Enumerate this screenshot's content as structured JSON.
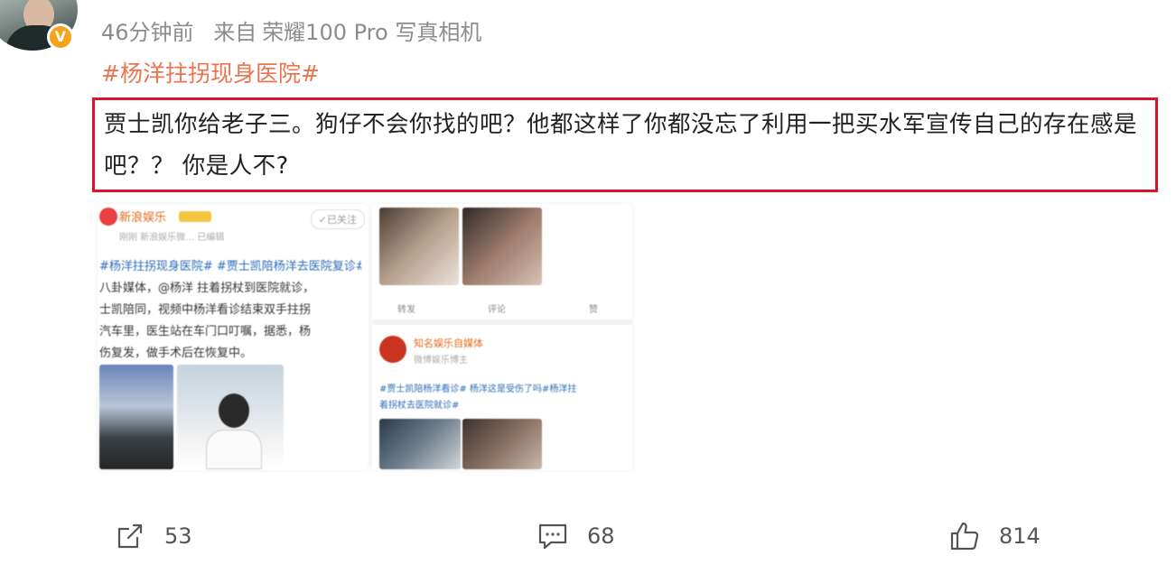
{
  "post": {
    "time": "46分钟前",
    "source_prefix": "来自",
    "device": "荣耀100 Pro 写真相机",
    "hashtag": "#杨洋拄拐现身医院#",
    "text": "贾士凯你给老子三。狗仔不会你找的吧？他都这样了你都没忘了利用一把买水军宣传自己的存在感是吧？？  你是人不?"
  },
  "embedded_left": {
    "account": "新浪娱乐",
    "follow_label": "✓已关注",
    "sub": "刚刚  新浪娱乐微…  已编辑",
    "lines": [
      "#杨洋拄拐现身医院# #贾士凯陪杨洋去医院复诊#",
      "八卦媒体，@杨洋 拄着拐杖到医院就诊，",
      "士凯陪同，视频中杨洋看诊结束双手拄拐",
      "汽车里，医生站在车门口叮嘱，据悉，杨",
      "伤复发，做手术后在恢复中。"
    ]
  },
  "embedded_right": {
    "action_labels": [
      "转发",
      "评论",
      "赞"
    ],
    "account": "知名娱乐自媒体",
    "sub": "微博娱乐博主",
    "line1": "#贾士凯陪杨洋看诊# 杨洋这是受伤了吗#杨洋拄",
    "line2": "着拐杖去医院就诊#"
  },
  "actions": {
    "share_count": "53",
    "comment_count": "68",
    "like_count": "814"
  },
  "colors": {
    "hashtag": "#eb7350",
    "highlight_border": "#d7142a",
    "meta_text": "#8c8c8c",
    "verified": "#f7a21b"
  },
  "icons": [
    "verified-icon",
    "share-icon",
    "comment-icon",
    "like-icon"
  ]
}
